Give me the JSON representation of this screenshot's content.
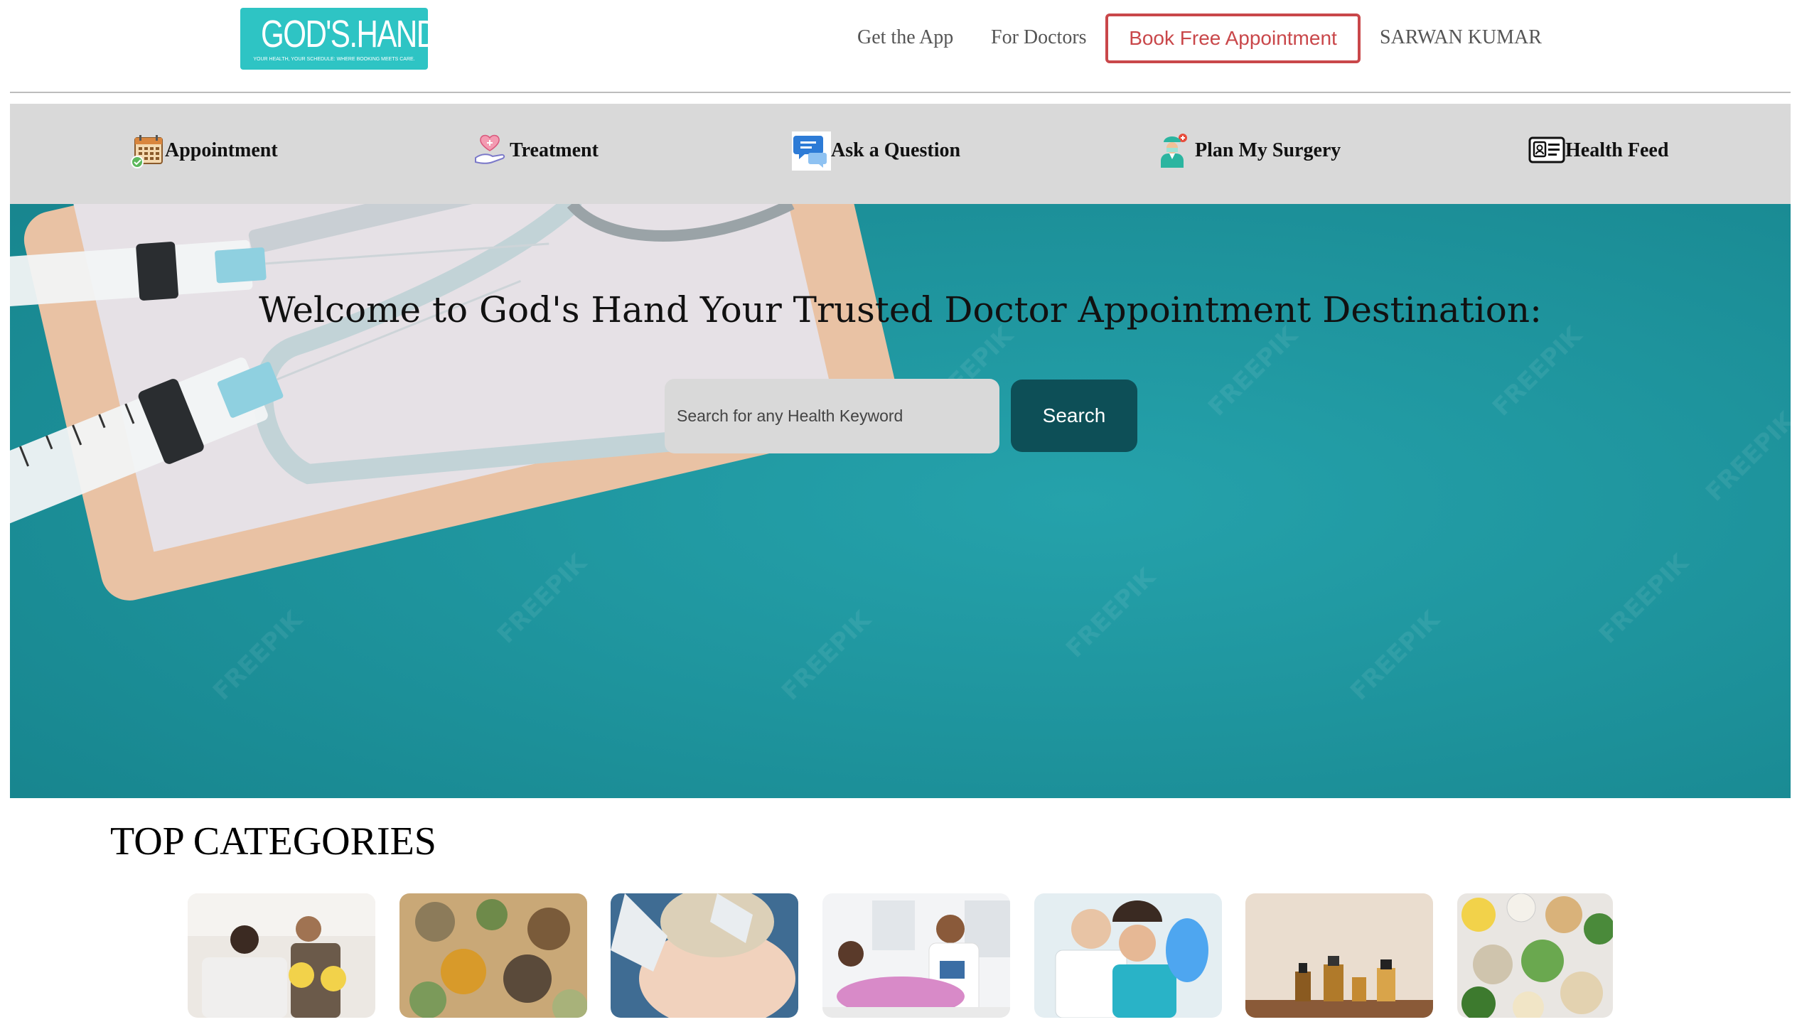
{
  "header": {
    "logo": {
      "title": "GOD'S.HAND",
      "tagline": "YOUR HEALTH, YOUR SCHEDULE: WHERE BOOKING MEETS CARE."
    },
    "nav": {
      "get_app": "Get the App",
      "for_doctors": "For Doctors",
      "book_appointment": "Book Free Appointment",
      "user_name": "SARWAN KUMAR"
    }
  },
  "category_bar": {
    "items": [
      {
        "label": "Appointment",
        "icon": "calendar-check-icon"
      },
      {
        "label": "Treatment",
        "icon": "heart-hand-icon"
      },
      {
        "label": "Ask a Question",
        "icon": "chat-bubbles-icon"
      },
      {
        "label": "Plan My Surgery",
        "icon": "surgeon-icon"
      },
      {
        "label": "Health Feed",
        "icon": "id-card-icon"
      }
    ]
  },
  "hero": {
    "title": "Welcome to God's Hand Your Trusted Doctor Appointment Destination:",
    "search_placeholder": "Search for any Health Keyword",
    "search_button": "Search"
  },
  "top_categories": {
    "title": "TOP CATEGORIES",
    "cards": [
      {
        "image": "therapy-session-photo"
      },
      {
        "image": "herbal-medicine-photo"
      },
      {
        "image": "dermatology-photo"
      },
      {
        "image": "pregnancy-checkup-photo"
      },
      {
        "image": "dental-care-photo"
      },
      {
        "image": "essential-oils-photo"
      },
      {
        "image": "healthy-food-photo"
      }
    ]
  },
  "colors": {
    "logo_bg": "#2ec4c4",
    "book_button": "#c9474a",
    "category_bar_bg": "#d9d9d9",
    "hero_bg": "#1f9aa3",
    "search_button_bg": "#0d4f57"
  }
}
